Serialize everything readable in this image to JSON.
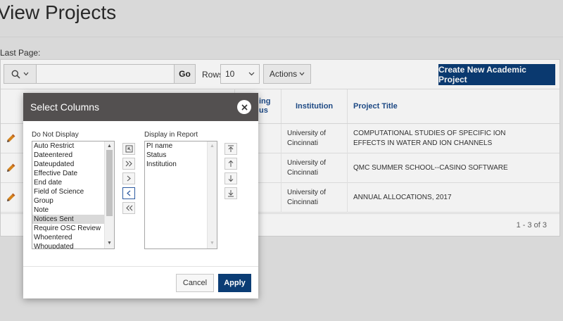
{
  "page": {
    "title": "View Projects",
    "last_page_label": "Last Page:"
  },
  "toolbar": {
    "search_column_icon": "search-icon",
    "search_placeholder": "",
    "go_label": "Go",
    "rows_label": "Rows",
    "rows_value": "10",
    "actions_label": "Actions",
    "create_label": "Create New Academic Project"
  },
  "table": {
    "peek_header_line1": "ing",
    "peek_header_line2": "us",
    "columns": {
      "institution": "Institution",
      "project_title": "Project Title"
    },
    "rows": [
      {
        "institution": "University of Cincinnati",
        "project_title": "COMPUTATIONAL STUDIES OF SPECIFIC ION EFFECTS IN WATER AND ION CHANNELS"
      },
      {
        "institution": "University of Cincinnati",
        "project_title": "QMC SUMMER SCHOOL--CASINO SOFTWARE"
      },
      {
        "institution": "University of Cincinnati",
        "project_title": "ANNUAL ALLOCATIONS, 2017"
      }
    ],
    "pagination": "1 - 3 of 3"
  },
  "dialog": {
    "title": "Select Columns",
    "left_label": "Do Not Display",
    "right_label": "Display in Report",
    "do_not_display": [
      "Auto Restrict",
      "Dateentered",
      "Dateupdated",
      "Effective Date",
      "End date",
      "Field of Science",
      "Group",
      "Note",
      "Notices Sent",
      "Require OSC Review",
      "Whoentered",
      "Whoupdated"
    ],
    "selected_item": "Notices Sent",
    "display_in_report": [
      "PI name",
      "Status",
      "Institution"
    ],
    "cancel_label": "Cancel",
    "apply_label": "Apply"
  },
  "colors": {
    "brand": "#0b3d75",
    "dialog_header": "#535050",
    "link": "#1f4d8c"
  }
}
